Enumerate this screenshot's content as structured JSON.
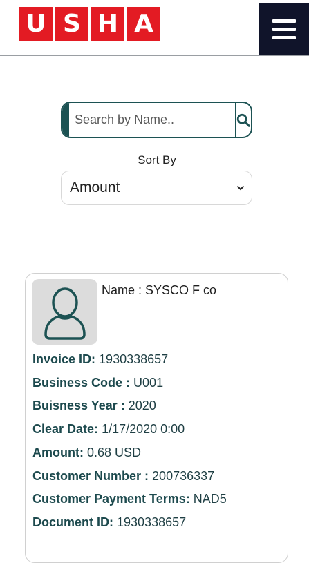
{
  "header": {
    "logo_letters": [
      "U",
      "S",
      "H",
      "A"
    ],
    "brand_color": "#e31b23",
    "menu_icon": "hamburger-icon"
  },
  "search": {
    "placeholder": "Search by Name..",
    "value": "",
    "icon": "search-icon"
  },
  "sort": {
    "label": "Sort By",
    "selected": "Amount"
  },
  "card": {
    "name_label": "Name : ",
    "name_value": "SYSCO F co",
    "fields": [
      {
        "label": "Invoice ID:",
        "value": "1930338657"
      },
      {
        "label": "Business Code :",
        "value": "U001"
      },
      {
        "label": "Buisness Year :",
        "value": "2020"
      },
      {
        "label": "Clear Date:",
        "value": "1/17/2020 0:00"
      },
      {
        "label": "Amount:",
        "value": "0.68 USD"
      },
      {
        "label": "Customer Number :",
        "value": "200736337"
      },
      {
        "label": "Customer Payment Terms:",
        "value": "NAD5"
      },
      {
        "label": "Document ID:",
        "value": "1930338657"
      }
    ]
  },
  "colors": {
    "accent": "#1c5253",
    "header_dark": "#10142a"
  }
}
